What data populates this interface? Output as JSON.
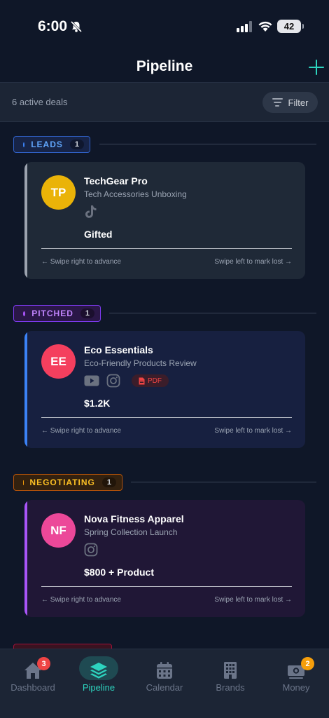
{
  "status_bar": {
    "time": "6:00",
    "battery": "42"
  },
  "header": {
    "title": "Pipeline"
  },
  "sub_bar": {
    "deal_count": "6 active deals",
    "filter_label": "Filter"
  },
  "stages": [
    {
      "label": "LEADS",
      "count": "1",
      "color": "#3b82f6",
      "deals": [
        {
          "initials": "TP",
          "brand": "TechGear Pro",
          "campaign": "Tech Accessories Unboxing",
          "platforms": [
            "tiktok-icon"
          ],
          "value": "Gifted",
          "avatar_color": "#eab308",
          "accent_color": "#9ca3af",
          "hint_left": "← Swipe right to advance",
          "hint_right": "Swipe left to mark lost →"
        }
      ]
    },
    {
      "label": "PITCHED",
      "count": "1",
      "color": "#a855f7",
      "deals": [
        {
          "initials": "EE",
          "brand": "Eco Essentials",
          "campaign": "Eco-Friendly Products Review",
          "platforms": [
            "youtube-icon",
            "instagram-icon"
          ],
          "attachment": "PDF",
          "value": "$1.2K",
          "avatar_color": "#f43f5e",
          "accent_color": "#3b82f6",
          "hint_left": "← Swipe right to advance",
          "hint_right": "Swipe left to mark lost →"
        }
      ]
    },
    {
      "label": "NEGOTIATING",
      "count": "1",
      "color": "#f59e0b",
      "deals": [
        {
          "initials": "NF",
          "brand": "Nova Fitness Apparel",
          "campaign": "Spring Collection Launch",
          "platforms": [
            "instagram-icon"
          ],
          "value": "$800 + Product",
          "avatar_color": "#ec4899",
          "accent_color": "#a855f7",
          "hint_left": "← Swipe right to advance",
          "hint_right": "Swipe left to mark lost →"
        }
      ]
    }
  ],
  "tab_bar": {
    "tabs": [
      {
        "label": "Dashboard",
        "icon": "home-icon",
        "badge": "3",
        "badge_color": "#ef4444"
      },
      {
        "label": "Pipeline",
        "icon": "layers-icon",
        "active": true
      },
      {
        "label": "Calendar",
        "icon": "calendar-icon"
      },
      {
        "label": "Brands",
        "icon": "building-icon"
      },
      {
        "label": "Money",
        "icon": "money-icon",
        "badge": "2",
        "badge_color": "#f59e0b"
      }
    ]
  }
}
